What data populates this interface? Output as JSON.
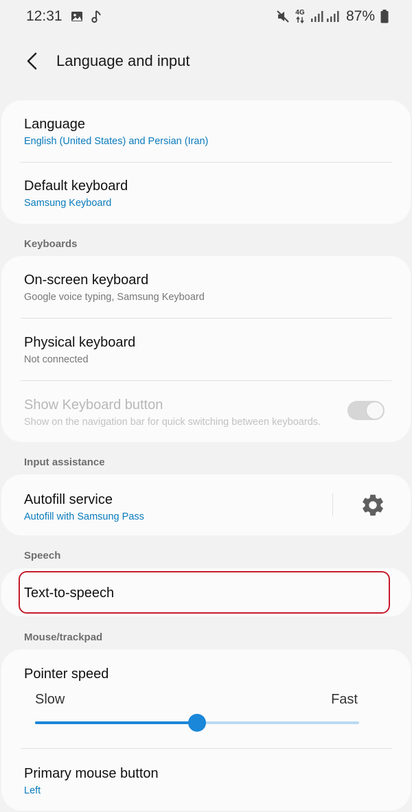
{
  "status_bar": {
    "time": "12:31",
    "network": "4G",
    "battery": "87%",
    "icons": [
      "image-icon",
      "music-note-icon",
      "mute-icon",
      "data-arrows-icon",
      "signal-icon",
      "battery-icon"
    ]
  },
  "header": {
    "title": "Language and input",
    "back_icon": "chevron-left-icon"
  },
  "group_general": {
    "items": [
      {
        "title": "Language",
        "subtitle": "English (United States) and Persian (Iran)"
      },
      {
        "title": "Default keyboard",
        "subtitle": "Samsung Keyboard"
      }
    ]
  },
  "keyboards": {
    "header": "Keyboards",
    "items": [
      {
        "title": "On-screen keyboard",
        "subtitle": "Google voice typing, Samsung Keyboard"
      },
      {
        "title": "Physical keyboard",
        "subtitle": "Not connected"
      },
      {
        "title": "Show Keyboard button",
        "subtitle": "Show on the navigation bar for quick switching between keyboards.",
        "enabled": false,
        "toggle_on": false
      }
    ]
  },
  "input_assistance": {
    "header": "Input assistance",
    "item": {
      "title": "Autofill service",
      "subtitle": "Autofill with Samsung Pass",
      "action_icon": "gear-icon"
    }
  },
  "speech": {
    "header": "Speech",
    "item": {
      "title": "Text-to-speech"
    }
  },
  "mouse": {
    "header": "Mouse/trackpad",
    "pointer_speed": {
      "title": "Pointer speed",
      "min_label": "Slow",
      "max_label": "Fast",
      "value": 0.5
    },
    "primary_button": {
      "title": "Primary mouse button",
      "subtitle": "Left"
    }
  },
  "colors": {
    "accent": "#0a7bbd",
    "slider": "#1a87d8",
    "highlight": "#c61b2b",
    "background": "#f2f2f2",
    "card": "#fbfbfb"
  }
}
